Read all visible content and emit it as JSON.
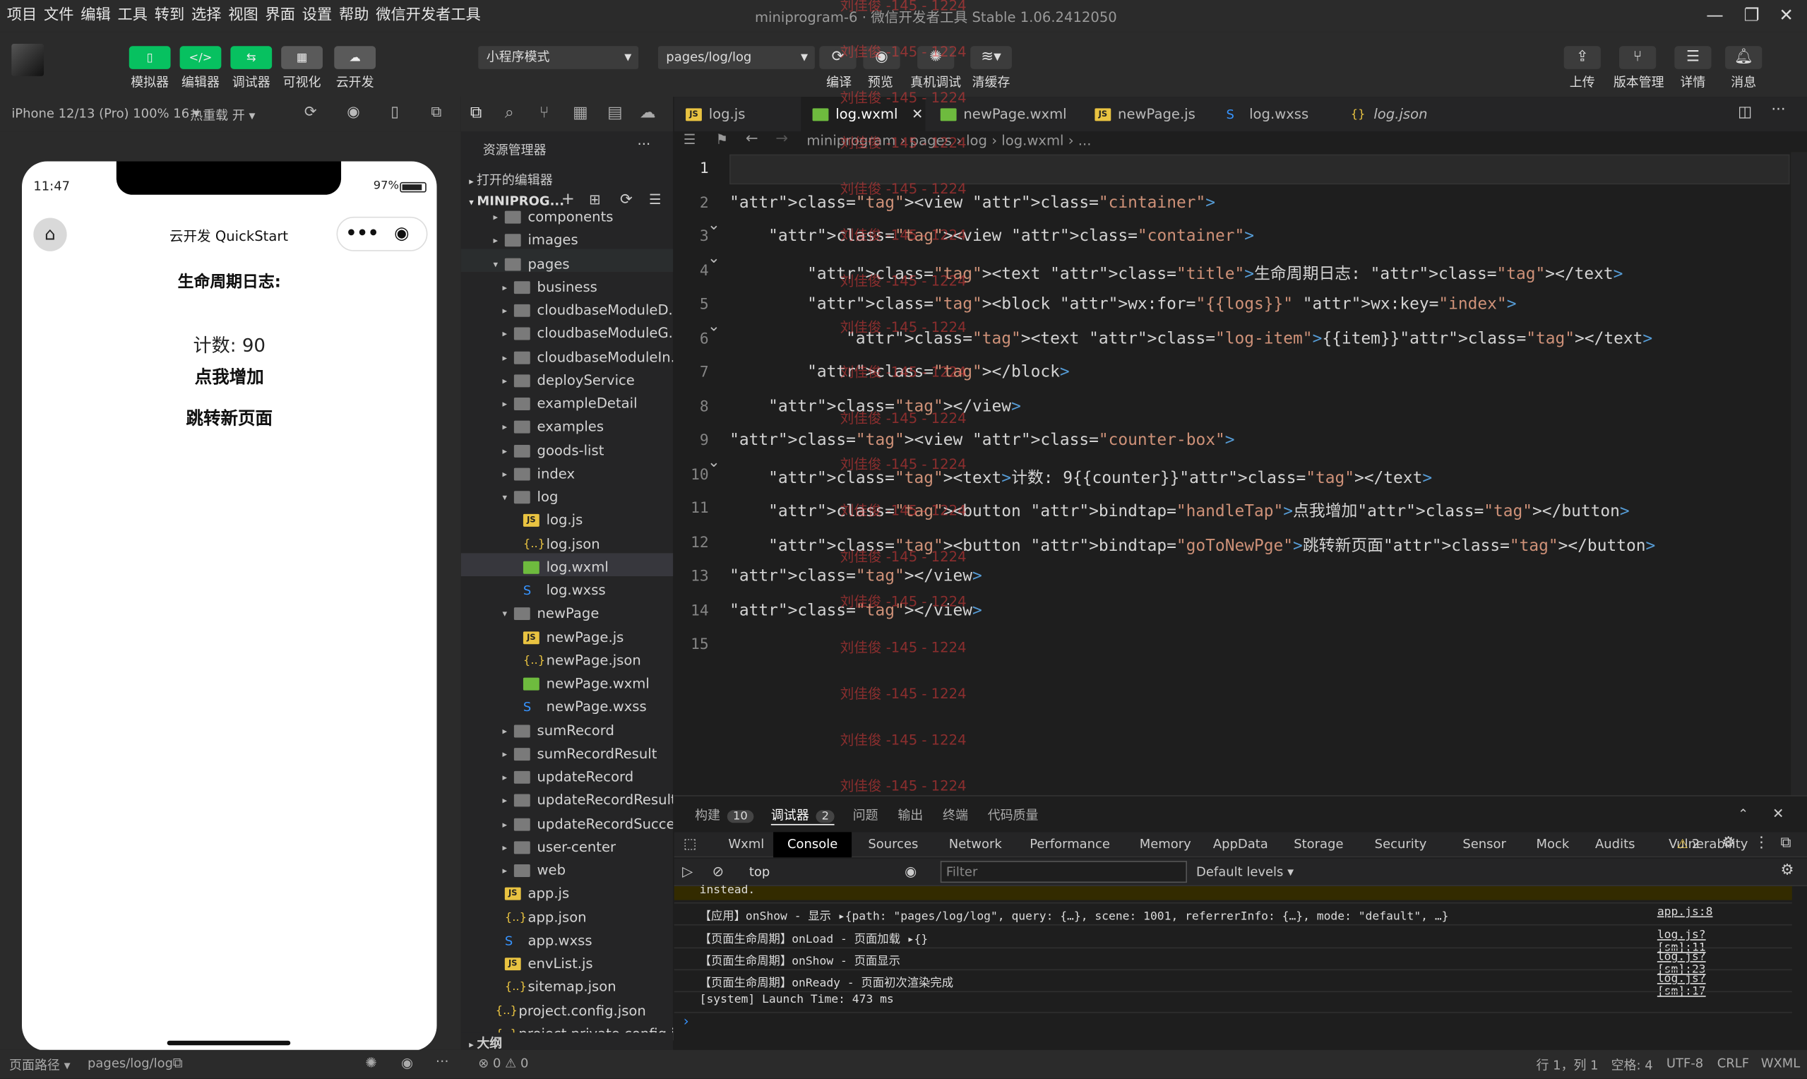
{
  "menu": [
    "项目",
    "文件",
    "编辑",
    "工具",
    "转到",
    "选择",
    "视图",
    "界面",
    "设置",
    "帮助",
    "微信开发者工具"
  ],
  "window_title": "miniprogram-6 · 微信开发者工具 Stable 1.06.2412050",
  "toolbar": {
    "left_buttons": [
      "模拟器",
      "编辑器",
      "调试器",
      "可视化",
      "云开发"
    ],
    "mode": "小程序模式",
    "page_path": "pages/log/log",
    "center_buttons": [
      "编译",
      "预览",
      "真机调试",
      "清缓存"
    ],
    "right_buttons": [
      "上传",
      "版本管理",
      "详情",
      "消息"
    ]
  },
  "simulator": {
    "device": "iPhone 12/13 (Pro) 100% 16 ▾",
    "hot_reload": "热重载 开 ▾",
    "time": "11:47",
    "battery": "97%",
    "nav_title": "云开发 QuickStart",
    "heading": "生命周期日志:",
    "count_text": "计数: 90",
    "button1": "点我增加",
    "button2": "跳转新页面"
  },
  "explorer": {
    "title": "资源管理器",
    "open_editors": "打开的编辑器",
    "project": "MINIPROG...",
    "outline": "大纲",
    "items": [
      {
        "label": "components",
        "indent": 0,
        "kind": "folder",
        "tw": "▸"
      },
      {
        "label": "images",
        "indent": 0,
        "kind": "folder",
        "tw": "▸"
      },
      {
        "label": "pages",
        "indent": 0,
        "kind": "folder",
        "tw": "▾"
      },
      {
        "label": "business",
        "indent": 1,
        "kind": "folder",
        "tw": "▸"
      },
      {
        "label": "cloudbaseModuleD...",
        "indent": 1,
        "kind": "folder",
        "tw": "▸"
      },
      {
        "label": "cloudbaseModuleG...",
        "indent": 1,
        "kind": "folder",
        "tw": "▸"
      },
      {
        "label": "cloudbaseModuleIn...",
        "indent": 1,
        "kind": "folder",
        "tw": "▸"
      },
      {
        "label": "deployService",
        "indent": 1,
        "kind": "folder",
        "tw": "▸"
      },
      {
        "label": "exampleDetail",
        "indent": 1,
        "kind": "folder",
        "tw": "▸"
      },
      {
        "label": "examples",
        "indent": 1,
        "kind": "folder",
        "tw": "▸"
      },
      {
        "label": "goods-list",
        "indent": 1,
        "kind": "folder",
        "tw": "▸"
      },
      {
        "label": "index",
        "indent": 1,
        "kind": "folder",
        "tw": "▸"
      },
      {
        "label": "log",
        "indent": 1,
        "kind": "folder",
        "tw": "▾"
      },
      {
        "label": "log.js",
        "indent": 2,
        "kind": "js",
        "tw": ""
      },
      {
        "label": "log.json",
        "indent": 2,
        "kind": "json",
        "tw": ""
      },
      {
        "label": "log.wxml",
        "indent": 2,
        "kind": "wxml",
        "tw": ""
      },
      {
        "label": "log.wxss",
        "indent": 2,
        "kind": "wxss",
        "tw": ""
      },
      {
        "label": "newPage",
        "indent": 1,
        "kind": "folder",
        "tw": "▾"
      },
      {
        "label": "newPage.js",
        "indent": 2,
        "kind": "js",
        "tw": ""
      },
      {
        "label": "newPage.json",
        "indent": 2,
        "kind": "json",
        "tw": ""
      },
      {
        "label": "newPage.wxml",
        "indent": 2,
        "kind": "wxml",
        "tw": ""
      },
      {
        "label": "newPage.wxss",
        "indent": 2,
        "kind": "wxss",
        "tw": ""
      },
      {
        "label": "sumRecord",
        "indent": 1,
        "kind": "folder",
        "tw": "▸"
      },
      {
        "label": "sumRecordResult",
        "indent": 1,
        "kind": "folder",
        "tw": "▸"
      },
      {
        "label": "updateRecord",
        "indent": 1,
        "kind": "folder",
        "tw": "▸"
      },
      {
        "label": "updateRecordResult",
        "indent": 1,
        "kind": "folder",
        "tw": "▸"
      },
      {
        "label": "updateRecordSuccess",
        "indent": 1,
        "kind": "folder",
        "tw": "▸"
      },
      {
        "label": "user-center",
        "indent": 1,
        "kind": "folder",
        "tw": "▸"
      },
      {
        "label": "web",
        "indent": 1,
        "kind": "folder",
        "tw": "▸"
      },
      {
        "label": "app.js",
        "indent": 0,
        "kind": "js",
        "tw": ""
      },
      {
        "label": "app.json",
        "indent": 0,
        "kind": "json",
        "tw": ""
      },
      {
        "label": "app.wxss",
        "indent": 0,
        "kind": "wxss",
        "tw": ""
      },
      {
        "label": "envList.js",
        "indent": 0,
        "kind": "js",
        "tw": ""
      },
      {
        "label": "sitemap.json",
        "indent": 0,
        "kind": "json",
        "tw": ""
      },
      {
        "label": "project.config.json",
        "indent": -1,
        "kind": "json",
        "tw": ""
      },
      {
        "label": "project.private.config.js...",
        "indent": -1,
        "kind": "json",
        "tw": ""
      }
    ]
  },
  "editor_tabs": [
    "log.js",
    "log.wxml",
    "newPage.wxml",
    "newPage.js",
    "log.wxss",
    "log.json"
  ],
  "breadcrumb": [
    "miniprogram",
    "pages",
    "log",
    "log.wxml",
    "..."
  ],
  "code_lines": [
    "",
    "<view class=\"cintainer\">",
    "    <view class=\"container\">",
    "        <text class=\"title\">生命周期日志: </text>",
    "        <block wx:for=\"{{logs}}\" wx:key=\"index\">",
    "            <text class=\"log-item\">{{item}}</text>",
    "        </block>",
    "    </view>",
    "<view class=\"counter-box\">",
    "    <text>计数: 9{{counter}}</text>",
    "    <button bindtap=\"handleTap\">点我增加</button>",
    "    <button bindtap=\"goToNewPge\">跳转新页面</button>",
    "</view>",
    "</view>",
    ""
  ],
  "watermark": "刘佳俊 -145 - 1224",
  "panel": {
    "tabs": [
      {
        "label": "构建",
        "badge": "10"
      },
      {
        "label": "调试器",
        "badge": "2"
      },
      {
        "label": "问题",
        "badge": ""
      },
      {
        "label": "输出",
        "badge": ""
      },
      {
        "label": "终端",
        "badge": ""
      },
      {
        "label": "代码质量",
        "badge": ""
      }
    ],
    "devtools_tabs": [
      "Wxml",
      "Console",
      "Sources",
      "Network",
      "Performance",
      "Memory",
      "AppData",
      "Storage",
      "Security",
      "Sensor",
      "Mock",
      "Audits",
      "Vulnerability"
    ],
    "warn_count": "2",
    "context": "top",
    "filter_placeholder": "Filter",
    "levels": "Default levels ▾",
    "console": [
      {
        "text": "instead.",
        "link": ""
      },
      {
        "text": "【应用】onShow - 显示 ▸{path: \"pages/log/log\", query: {…}, scene: 1001, referrerInfo: {…}, mode: \"default\", …}",
        "link": "app.js:8"
      },
      {
        "text": "【页面生命周期】onLoad - 页面加载 ▸{}",
        "link": "log.js? [sm]:11"
      },
      {
        "text": "【页面生命周期】onShow - 页面显示",
        "link": "log.js? [sm]:23"
      },
      {
        "text": "【页面生命周期】onReady - 页面初次渲染完成",
        "link": "log.js? [sm]:17"
      },
      {
        "text": "[system] Launch Time: 473 ms",
        "link": ""
      }
    ]
  },
  "status": {
    "path_label": "页面路径 ▾",
    "path": "pages/log/log",
    "errors": "⊗ 0 ⚠ 0",
    "position": "行 1，列 1",
    "spaces": "空格: 4",
    "encoding": "UTF-8",
    "eol": "CRLF",
    "lang": "WXML"
  }
}
